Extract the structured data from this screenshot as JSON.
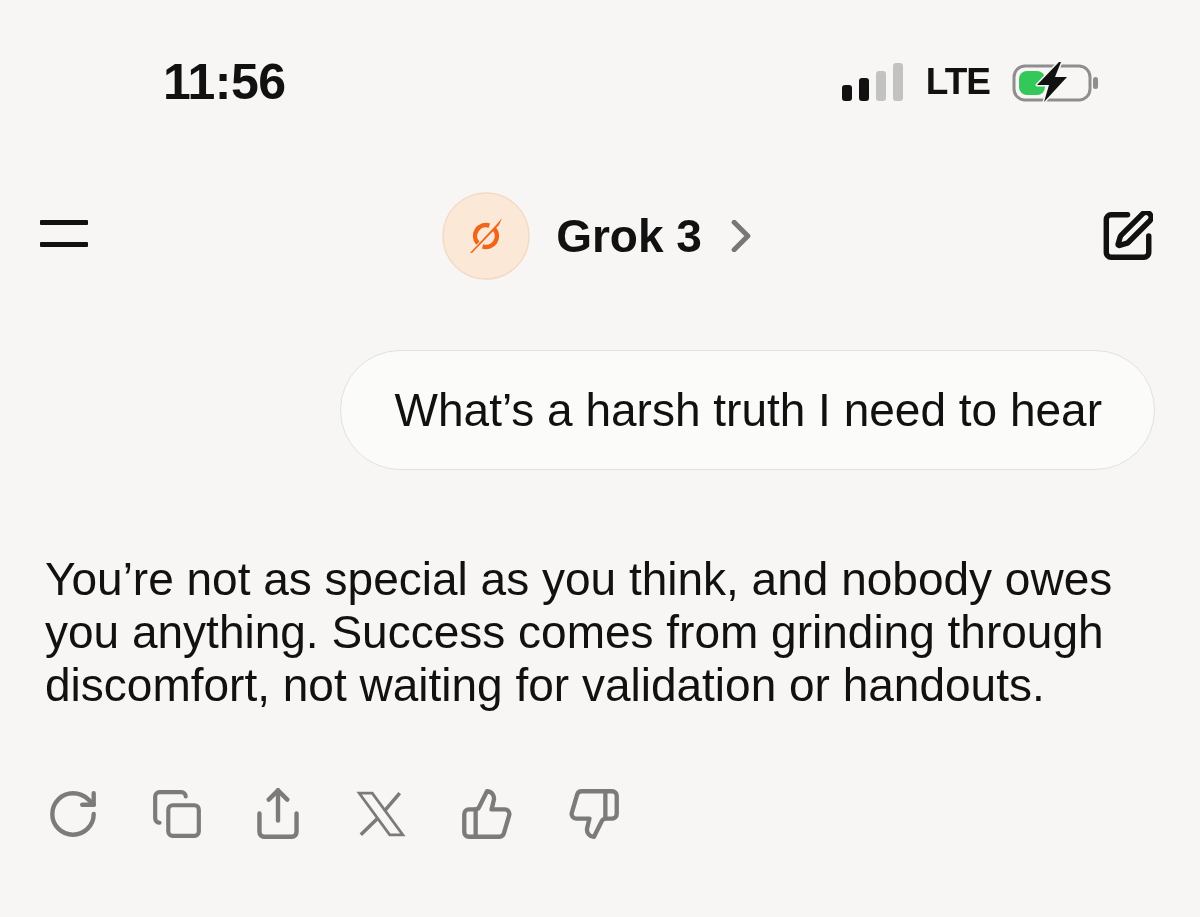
{
  "status_bar": {
    "time": "11:56",
    "network": "LTE"
  },
  "header": {
    "title": "Grok 3"
  },
  "messages": [
    {
      "kind": "user",
      "text": "What’s a harsh truth I need to hear"
    },
    {
      "kind": "assistant",
      "text": "You’re not as special as you think, and nobody owes you anything. Success comes from grinding through discomfort, not waiting for validation or handouts."
    }
  ]
}
